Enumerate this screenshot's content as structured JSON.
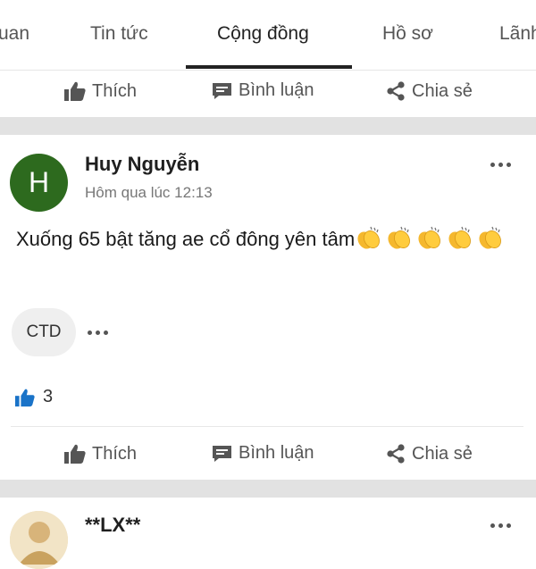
{
  "tabs": [
    {
      "label": "uan"
    },
    {
      "label": "Tin tức"
    },
    {
      "label": "Cộng đồng"
    },
    {
      "label": "Hồ sơ"
    },
    {
      "label": "Lãnh"
    }
  ],
  "actions": {
    "like_label": "Thích",
    "comment_label": "Bình luận",
    "share_label": "Chia sẻ"
  },
  "post": {
    "avatar_initial": "H",
    "author": "Huy Nguyễn",
    "time": "Hôm qua lúc 12:13",
    "text": "Xuống 65 bật tăng ae cổ đông yên tâm",
    "emoji_icon": "clapping-hands-icon",
    "emoji_count": 5,
    "tag": "CTD",
    "like_count": "3"
  },
  "next_post": {
    "author": "**LX**"
  },
  "colors": {
    "avatar_bg": "#2d6a1e",
    "like_blue": "#1a73c8",
    "icon_gray": "#555555",
    "separator": "#e2e2e2"
  }
}
